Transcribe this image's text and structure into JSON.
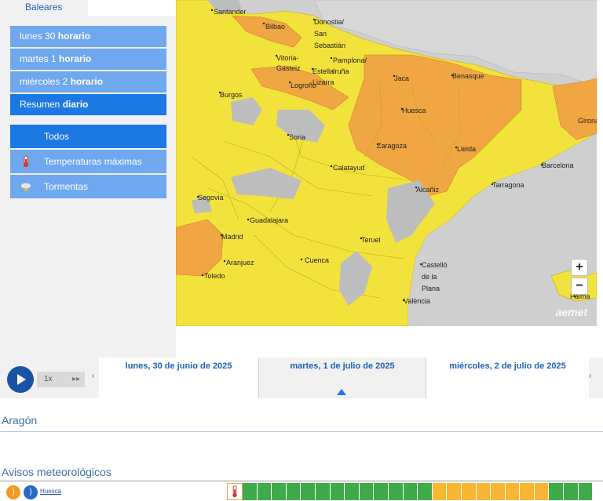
{
  "region_tab": "Baleares",
  "days": [
    {
      "pre": "lunes 30 ",
      "bold": "horario",
      "active": false
    },
    {
      "pre": "martes 1 ",
      "bold": "horario",
      "active": false
    },
    {
      "pre": "miércoles 2 ",
      "bold": "horario",
      "active": false
    },
    {
      "pre": "Resumen ",
      "bold": "diario",
      "active": true
    }
  ],
  "filters": [
    {
      "label": "Todos",
      "icon": "none",
      "active": true
    },
    {
      "label": "Temperaturas máximas",
      "icon": "thermometer-icon",
      "active": false
    },
    {
      "label": "Tormentas",
      "icon": "storm-icon",
      "active": false
    }
  ],
  "map": {
    "cities": [
      "Santander",
      "Bilbao",
      "Donostia/",
      "San",
      "Sebastián",
      "Vitoria-",
      "Gasteiz",
      "Pamplona/",
      "Iruña",
      "Estella",
      "Lizarra",
      "Logroño",
      "Burgos",
      "Jaca",
      "Benasque",
      "Huesca",
      "Soria",
      "Zaragoza",
      "Lleida",
      "Girona",
      "Calatayud",
      "Barcelona",
      "Tarragona",
      "Alcañiz",
      "Segovia",
      "Guadalajara",
      "Madrid",
      "Teruel",
      "Aranjuez",
      "Cuenca",
      "Toledo",
      "Castelló",
      "de la",
      "Plana",
      "València",
      "Palma"
    ],
    "zoom_in": "+",
    "zoom_out": "−",
    "logo": "aemet",
    "colors": {
      "yellow": "#f2e23c",
      "orange": "#f0a642",
      "grey": "#bdbdbd",
      "sea": "#cfcfcf"
    }
  },
  "timeline": {
    "speed": "1x",
    "ffwd": "▸▸",
    "prev": "‹",
    "next": "›",
    "days": [
      "lunes, 30 de junio de 2025",
      "martes, 1 de julio de 2025",
      "miércoles, 2 de julio de 2025"
    ]
  },
  "region_title": "Aragón",
  "warnings_title": "Avisos meteorológicos",
  "warning_row": {
    "location": "Huesca",
    "rss_icon": "rss-icon",
    "wifi_icon": "feed-icon",
    "cells": [
      "g",
      "g",
      "g",
      "g",
      "g",
      "g",
      "g",
      "g",
      "g",
      "g",
      "g",
      "g",
      "g",
      "y",
      "y",
      "y",
      "y",
      "y",
      "y",
      "y",
      "y",
      "g",
      "g",
      "g"
    ]
  }
}
